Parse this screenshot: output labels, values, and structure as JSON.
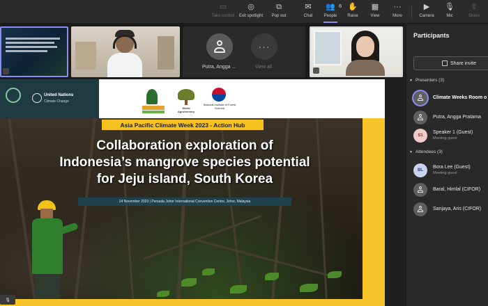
{
  "toolbar": {
    "items": [
      {
        "label": "Take control",
        "icon": "take-control-icon"
      },
      {
        "label": "Exit spotlight",
        "icon": "exit-spotlight-icon"
      },
      {
        "label": "Pop out",
        "icon": "pop-out-icon"
      },
      {
        "label": "Chat",
        "icon": "chat-icon"
      },
      {
        "label": "People",
        "icon": "people-icon",
        "badge": "6"
      },
      {
        "label": "Raise",
        "icon": "raise-hand-icon"
      },
      {
        "label": "View",
        "icon": "view-icon"
      },
      {
        "label": "More",
        "icon": "more-icon"
      },
      {
        "label": "Camera",
        "icon": "camera-icon"
      },
      {
        "label": "Mic",
        "icon": "mic-icon"
      },
      {
        "label": "Share",
        "icon": "share-icon"
      }
    ],
    "accent": "#8b8cf5"
  },
  "video_strip": {
    "tile3_name": "Putra, Angga ...",
    "tile3_more": "View all"
  },
  "slide": {
    "org_title": "United Nations",
    "org_sub": "Climate Change",
    "logo_cifor": "CIFOR",
    "logo_wa": "World Agroforestry",
    "logo_nifos": "National Institute of Forest Science",
    "event_tag": "Asia Pacific Climate Week 2023 - Action Hub",
    "title_line1": "Collaboration exploration of",
    "title_line2": "Indonesia’s mangrove species potential",
    "title_line3": "for Jeju island, South Korea",
    "meta": "14 November 2023   |   Persada Johor International Convention Centre, Johor, Malaysia",
    "accent_yellow": "#f7c52a"
  },
  "panel": {
    "title": "Participants",
    "share_label": "Share invite",
    "presenters_header": "Presenters (3)",
    "attendees_header": "Attendees (3)",
    "presenters": [
      {
        "name": "Climate Weeks Room o",
        "sub": "",
        "initials": "",
        "style": "gray-ring"
      },
      {
        "name": "Putra, Angga Pratama",
        "sub": "",
        "initials": "",
        "style": "gray"
      },
      {
        "name": "Speaker 1 (Guest)",
        "sub": "Meeting guest",
        "initials": "S1",
        "style": "pink"
      }
    ],
    "attendees": [
      {
        "name": "Bora Lee (Guest)",
        "sub": "Meeting guest",
        "initials": "BL",
        "style": "blue"
      },
      {
        "name": "Baral, Himlal (CIFOR)",
        "sub": "",
        "initials": "",
        "style": "gray"
      },
      {
        "name": "Sanjaya, Aris (CIFOR)",
        "sub": "",
        "initials": "",
        "style": "gray"
      }
    ]
  }
}
